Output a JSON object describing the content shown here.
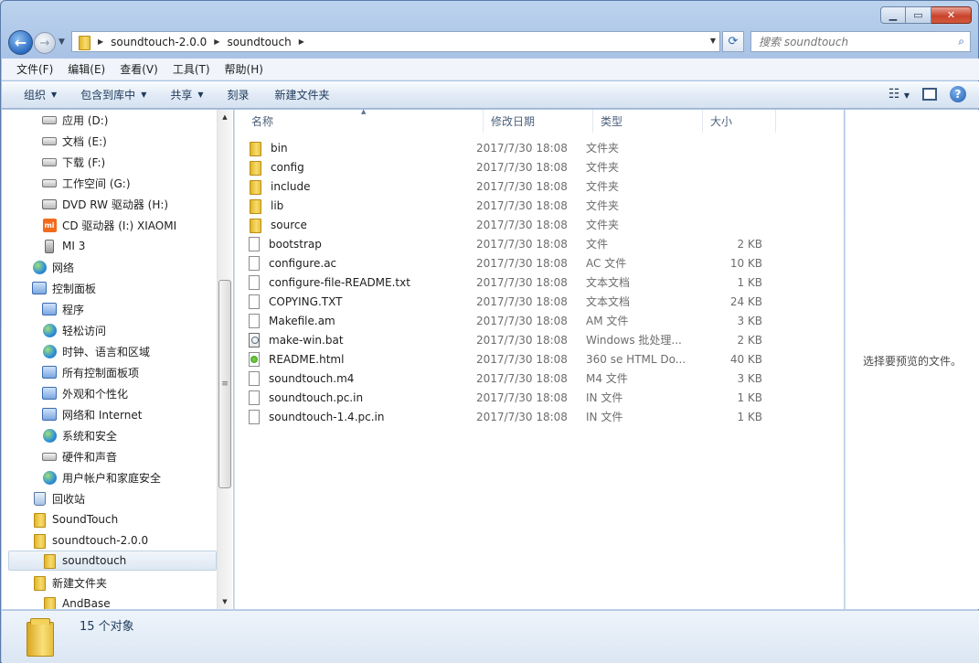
{
  "address": {
    "crumbs": [
      "soundtouch-2.0.0",
      "soundtouch"
    ]
  },
  "search": {
    "placeholder": "搜索 soundtouch"
  },
  "menu": [
    "文件(F)",
    "编辑(E)",
    "查看(V)",
    "工具(T)",
    "帮助(H)"
  ],
  "toolbar": {
    "organize": "组织",
    "include": "包含到库中",
    "share": "共享",
    "burn": "刻录",
    "new_folder": "新建文件夹"
  },
  "nav": [
    {
      "label": "应用 (D:)",
      "icon": "drive-icon"
    },
    {
      "label": "文档 (E:)",
      "icon": "drive-icon"
    },
    {
      "label": "下载 (F:)",
      "icon": "drive-icon"
    },
    {
      "label": "工作空间 (G:)",
      "icon": "drive-icon"
    },
    {
      "label": "DVD RW 驱动器 (H:)",
      "icon": "dvd-drive-icon"
    },
    {
      "label": "CD 驱动器 (I:) XIAOMI",
      "icon": "mi-cd-drive-icon"
    },
    {
      "label": "MI 3",
      "icon": "phone-icon"
    },
    {
      "label": "网络",
      "icon": "network-icon"
    },
    {
      "label": "控制面板",
      "icon": "control-panel-icon"
    },
    {
      "label": "程序",
      "icon": "programs-icon"
    },
    {
      "label": "轻松访问",
      "icon": "ease-of-access-icon"
    },
    {
      "label": "时钟、语言和区域",
      "icon": "clock-language-icon"
    },
    {
      "label": "所有控制面板项",
      "icon": "control-panel-items-icon"
    },
    {
      "label": "外观和个性化",
      "icon": "appearance-icon"
    },
    {
      "label": "网络和 Internet",
      "icon": "network-internet-icon"
    },
    {
      "label": "系统和安全",
      "icon": "system-security-icon"
    },
    {
      "label": "硬件和声音",
      "icon": "hardware-sound-icon"
    },
    {
      "label": "用户帐户和家庭安全",
      "icon": "user-accounts-icon"
    },
    {
      "label": "回收站",
      "icon": "recycle-bin-icon"
    },
    {
      "label": "SoundTouch",
      "icon": "folder-icon"
    },
    {
      "label": "soundtouch-2.0.0",
      "icon": "folder-icon"
    },
    {
      "label": "soundtouch",
      "icon": "folder-icon"
    },
    {
      "label": "新建文件夹",
      "icon": "folder-icon"
    },
    {
      "label": "AndBase",
      "icon": "folder-icon"
    }
  ],
  "columns": {
    "name": "名称",
    "date": "修改日期",
    "type": "类型",
    "size": "大小"
  },
  "files": [
    {
      "name": "bin",
      "date": "2017/7/30 18:08",
      "type": "文件夹",
      "size": "",
      "kind": "folder"
    },
    {
      "name": "config",
      "date": "2017/7/30 18:08",
      "type": "文件夹",
      "size": "",
      "kind": "folder"
    },
    {
      "name": "include",
      "date": "2017/7/30 18:08",
      "type": "文件夹",
      "size": "",
      "kind": "folder"
    },
    {
      "name": "lib",
      "date": "2017/7/30 18:08",
      "type": "文件夹",
      "size": "",
      "kind": "folder"
    },
    {
      "name": "source",
      "date": "2017/7/30 18:08",
      "type": "文件夹",
      "size": "",
      "kind": "folder"
    },
    {
      "name": "bootstrap",
      "date": "2017/7/30 18:08",
      "type": "文件",
      "size": "2 KB",
      "kind": "file"
    },
    {
      "name": "configure.ac",
      "date": "2017/7/30 18:08",
      "type": "AC 文件",
      "size": "10 KB",
      "kind": "file"
    },
    {
      "name": "configure-file-README.txt",
      "date": "2017/7/30 18:08",
      "type": "文本文档",
      "size": "1 KB",
      "kind": "file"
    },
    {
      "name": "COPYING.TXT",
      "date": "2017/7/30 18:08",
      "type": "文本文档",
      "size": "24 KB",
      "kind": "file"
    },
    {
      "name": "Makefile.am",
      "date": "2017/7/30 18:08",
      "type": "AM 文件",
      "size": "3 KB",
      "kind": "file"
    },
    {
      "name": "make-win.bat",
      "date": "2017/7/30 18:08",
      "type": "Windows 批处理...",
      "size": "2 KB",
      "kind": "bat"
    },
    {
      "name": "README.html",
      "date": "2017/7/30 18:08",
      "type": "360 se HTML Do...",
      "size": "40 KB",
      "kind": "html"
    },
    {
      "name": "soundtouch.m4",
      "date": "2017/7/30 18:08",
      "type": "M4 文件",
      "size": "3 KB",
      "kind": "file"
    },
    {
      "name": "soundtouch.pc.in",
      "date": "2017/7/30 18:08",
      "type": "IN 文件",
      "size": "1 KB",
      "kind": "file"
    },
    {
      "name": "soundtouch-1.4.pc.in",
      "date": "2017/7/30 18:08",
      "type": "IN 文件",
      "size": "1 KB",
      "kind": "file"
    }
  ],
  "preview_text": "选择要预览的文件。",
  "status": {
    "count": "15 个对象"
  }
}
